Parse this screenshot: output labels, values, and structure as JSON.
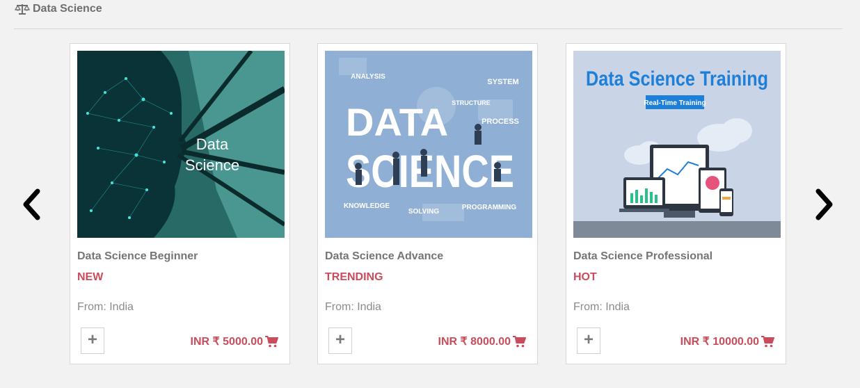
{
  "section": {
    "icon": "balance-scale-icon",
    "title": "Data Science"
  },
  "carousel": {
    "prev_icon": "chevron-left-icon",
    "next_icon": "chevron-right-icon",
    "cards": [
      {
        "image_caption_lines": [
          "Data",
          "Science"
        ],
        "title": "Data Science Beginner",
        "badge": "NEW",
        "origin": "From: India",
        "add_label": "+",
        "price": "INR ₹ 5000.00",
        "cart_icon": "shopping-cart-icon"
      },
      {
        "image_big_text": [
          "DATA",
          "SCIENCE"
        ],
        "image_labels": [
          "ANALYSIS",
          "SYSTEM",
          "STRUCTURE",
          "PROCESS",
          "KNOWLEDGE",
          "SOLVING",
          "PROGRAMMING"
        ],
        "title": "Data Science Advance",
        "badge": "TRENDING",
        "origin": "From: India",
        "add_label": "+",
        "price": "INR ₹ 8000.00",
        "cart_icon": "shopping-cart-icon"
      },
      {
        "image_heading": "Data Science Training",
        "image_subheading": "Real-Time Training",
        "title": "Data Science Professional",
        "badge": "HOT",
        "origin": "From: India",
        "add_label": "+",
        "price": "INR ₹ 10000.00",
        "cart_icon": "shopping-cart-icon"
      }
    ]
  },
  "colors": {
    "background": "#f2f2f2",
    "accent": "#cc4b5b",
    "title_gray": "#757575"
  }
}
